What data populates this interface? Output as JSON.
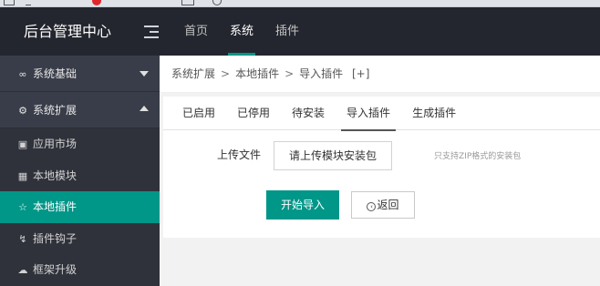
{
  "header": {
    "brand": "后台管理中心",
    "nav": [
      {
        "label": "首页",
        "active": false
      },
      {
        "label": "系统",
        "active": true
      },
      {
        "label": "插件",
        "active": false
      }
    ]
  },
  "sidebar": {
    "groups": [
      {
        "label": "系统基础",
        "icon": "grid-icon",
        "expanded": false
      },
      {
        "label": "系统扩展",
        "icon": "gear-icon",
        "expanded": true
      }
    ],
    "items": [
      {
        "label": "应用市场",
        "icon": "store-icon",
        "active": false
      },
      {
        "label": "本地模块",
        "icon": "modules-icon",
        "active": false
      },
      {
        "label": "本地插件",
        "icon": "plugin-icon",
        "active": true
      },
      {
        "label": "插件钩子",
        "icon": "hook-icon",
        "active": false
      },
      {
        "label": "框架升级",
        "icon": "cloud-upgrade-icon",
        "active": false
      }
    ]
  },
  "breadcrumb": {
    "items": [
      "系统扩展",
      "本地插件",
      "导入插件"
    ],
    "separator": ">",
    "extra": "[+]"
  },
  "tabs": [
    {
      "label": "已启用",
      "active": false
    },
    {
      "label": "已停用",
      "active": false
    },
    {
      "label": "待安装",
      "active": false
    },
    {
      "label": "导入插件",
      "active": true
    },
    {
      "label": "生成插件",
      "active": false
    }
  ],
  "form": {
    "upload_label": "上传文件",
    "upload_button": "请上传模块安装包",
    "hint": "只支持ZIP格式的安装包",
    "import_button": "开始导入",
    "back_button": "返回"
  },
  "colors": {
    "header_bg": "#23262e",
    "sidebar_bg": "#393d49",
    "accent": "#009688"
  }
}
